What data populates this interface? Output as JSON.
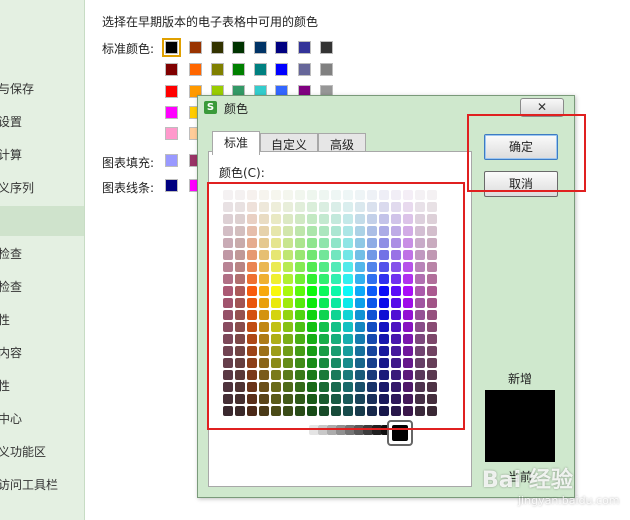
{
  "sidebar": {
    "items": [
      {
        "label": "与保存"
      },
      {
        "label": "设置"
      },
      {
        "label": "计算"
      },
      {
        "label": "义序列"
      },
      {
        "label": ""
      },
      {
        "label": "检查"
      },
      {
        "label": "检查"
      },
      {
        "label": "性"
      },
      {
        "label": "内容"
      },
      {
        "label": "性"
      },
      {
        "label": "中心"
      },
      {
        "label": "义功能区"
      },
      {
        "label": "访问工具栏"
      }
    ]
  },
  "main": {
    "heading": "选择在早期版本的电子表格中可用的颜色",
    "standard_label": "标准颜色:",
    "fill_label": "图表填充:",
    "line_label": "图表线条:",
    "standard_colors": [
      [
        "#000000",
        "#993300",
        "#333300",
        "#003300",
        "#003366",
        "#000080",
        "#333399",
        "#333333"
      ],
      [
        "#800000",
        "#FF6600",
        "#808000",
        "#008000",
        "#008080",
        "#0000FF",
        "#666699",
        "#808080"
      ],
      [
        "#FF0000",
        "#FF9900",
        "#99CC00",
        "#339966",
        "#33CCCC",
        "#3366FF",
        "#800080",
        "#969696"
      ],
      [
        "#FF00FF",
        "#FFCC00",
        "#FFFF00",
        "#00FF00",
        "#00FFFF",
        "#00CCFF",
        "#993366",
        "#C0C0C0"
      ],
      [
        "#FF99CC",
        "#FFCC99",
        "#FFFF99",
        "#CCFFCC",
        "#CCFFFF",
        "#99CCFF",
        "#CC99FF",
        "#FFFFFF"
      ]
    ],
    "fill_colors": [
      "#9999FF",
      "#993366"
    ],
    "line_colors": [
      "#000080",
      "#FF00FF"
    ]
  },
  "dialog": {
    "icon_letter": "S",
    "title": "颜色",
    "close_symbol": "✕",
    "tabs": [
      {
        "label": "标准"
      },
      {
        "label": "自定义"
      },
      {
        "label": "高级"
      }
    ],
    "colors_label": "颜色(C):",
    "ok_label": "确定",
    "cancel_label": "取消",
    "new_label": "新增",
    "current_label": "当前",
    "new_color": "#000000"
  },
  "watermark": {
    "text": "Bai 经验",
    "sub": "jingyan.baidu.com"
  }
}
